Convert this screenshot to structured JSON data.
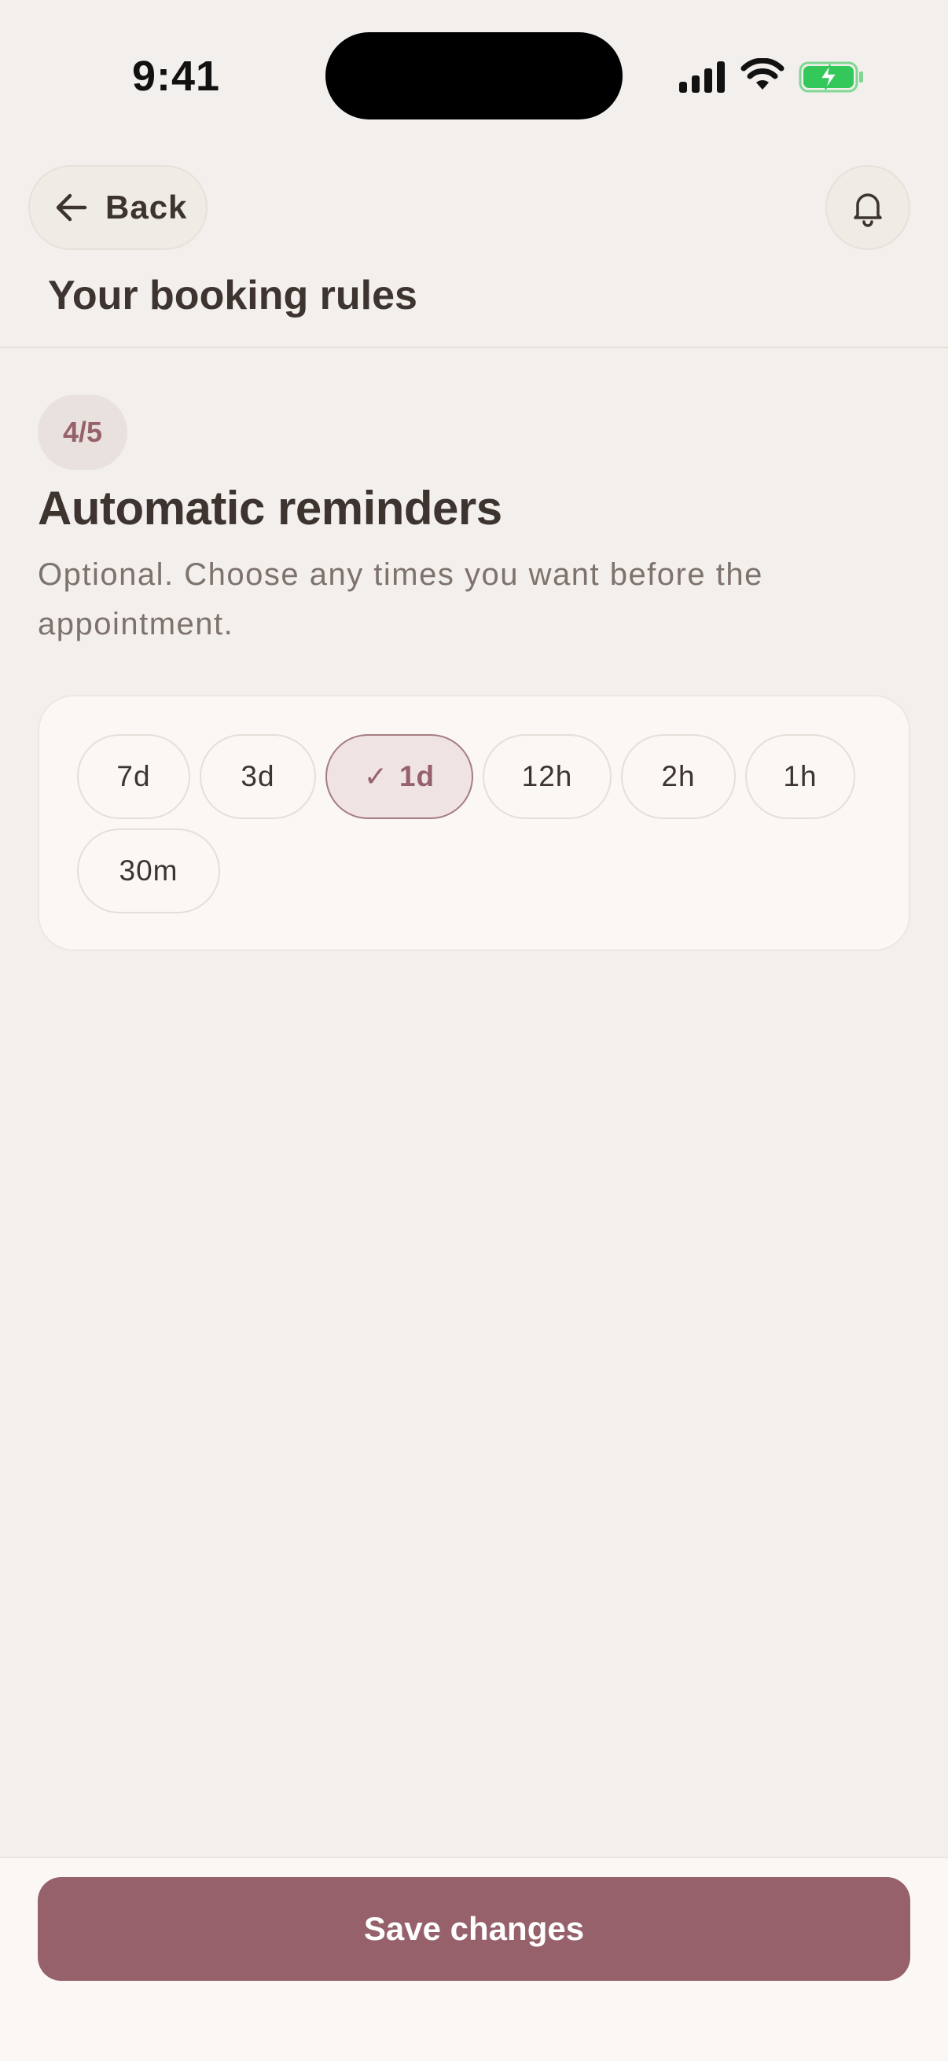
{
  "status_bar": {
    "time": "9:41"
  },
  "header": {
    "back_label": "Back",
    "back_icon": "arrow-left-icon",
    "bell_icon": "bell-icon",
    "page_title": "Your booking rules"
  },
  "step": {
    "badge": "4/5",
    "title": "Automatic reminders",
    "description": "Optional. Choose any times you want before the appointment."
  },
  "reminders": {
    "options": [
      {
        "label": "7d",
        "selected": false
      },
      {
        "label": "3d",
        "selected": false
      },
      {
        "label": "1d",
        "selected": true
      },
      {
        "label": "12h",
        "selected": false
      },
      {
        "label": "2h",
        "selected": false
      },
      {
        "label": "1h",
        "selected": false
      },
      {
        "label": "30m",
        "selected": false
      }
    ],
    "check_glyph": "✓"
  },
  "footer": {
    "save_label": "Save changes"
  },
  "colors": {
    "background": "#f2efec",
    "accent": "#96616b",
    "text": "#3d3430",
    "muted_text": "#7e726c",
    "selected_chip_bg": "#efe3e3",
    "battery_green": "#34c759"
  }
}
